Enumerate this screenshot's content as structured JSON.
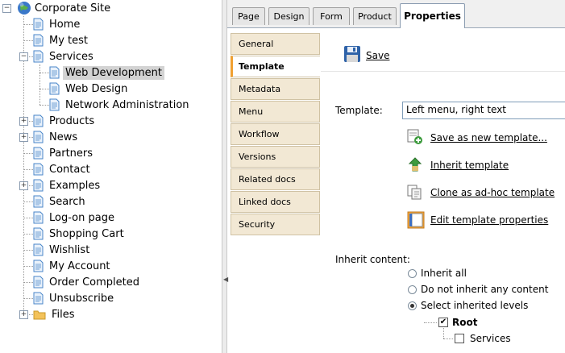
{
  "tree": {
    "root": "Corporate Site",
    "items": [
      {
        "label": "Home"
      },
      {
        "label": "My test"
      },
      {
        "label": "Services"
      },
      {
        "label": "Web Development"
      },
      {
        "label": "Web Design"
      },
      {
        "label": "Network Administration"
      },
      {
        "label": "Products"
      },
      {
        "label": "News"
      },
      {
        "label": "Partners"
      },
      {
        "label": "Contact"
      },
      {
        "label": "Examples"
      },
      {
        "label": "Search"
      },
      {
        "label": "Log-on page"
      },
      {
        "label": "Shopping Cart"
      },
      {
        "label": "Wishlist"
      },
      {
        "label": "My Account"
      },
      {
        "label": "Order Completed"
      },
      {
        "label": "Unsubscribe"
      },
      {
        "label": "Files"
      }
    ]
  },
  "tabs": [
    "Page",
    "Design",
    "Form",
    "Product",
    "Properties"
  ],
  "vtabs": [
    "General",
    "Template",
    "Metadata",
    "Menu",
    "Workflow",
    "Versions",
    "Related docs",
    "Linked docs",
    "Security"
  ],
  "content": {
    "save": "Save",
    "template_label": "Template:",
    "template_value": "Left menu, right text",
    "actions": [
      "Save as new template...",
      "Inherit template",
      "Clone as ad-hoc template",
      "Edit template properties"
    ],
    "inherit_label": "Inherit content:",
    "radios": [
      "Inherit all",
      "Do not inherit any content",
      "Select inherited levels"
    ],
    "levels": [
      "Root",
      "Services"
    ]
  },
  "colors": {
    "selected_bg": "#d3d3d3",
    "vtab_bg": "#f2e8d4",
    "vtab_accent": "#f0a030"
  }
}
